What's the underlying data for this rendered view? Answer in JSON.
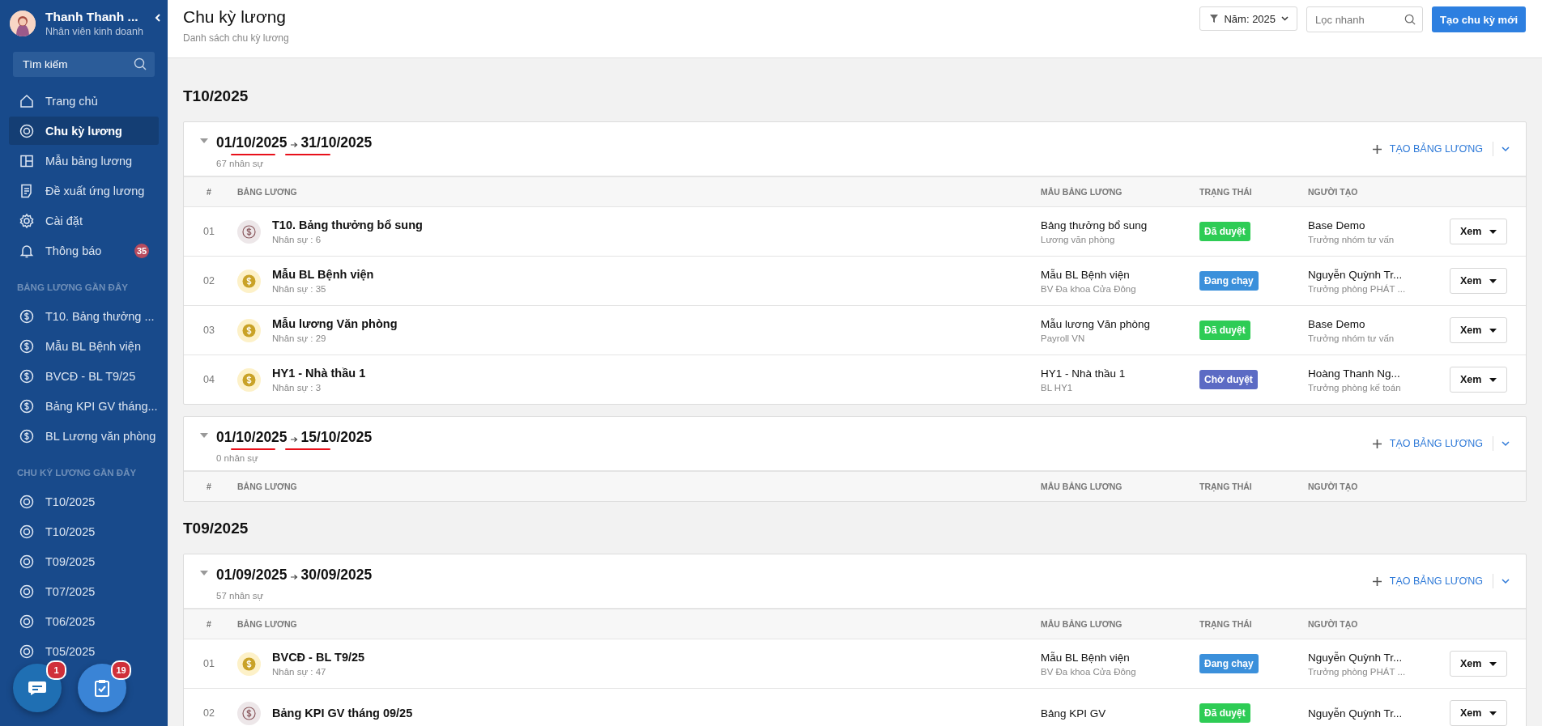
{
  "sidebar": {
    "user": {
      "name": "Thanh Thanh ...",
      "role": "Nhân viên kinh doanh"
    },
    "search": {
      "placeholder": "Tìm kiếm"
    },
    "nav": [
      {
        "label": "Trang chủ",
        "kind": "home",
        "selected": false
      },
      {
        "label": "Chu kỳ lương",
        "kind": "cycle",
        "selected": true
      },
      {
        "label": "Mẫu bảng lương",
        "kind": "template",
        "selected": false
      },
      {
        "label": "Đề xuất ứng lương",
        "kind": "proposal",
        "selected": false
      },
      {
        "label": "Cài đặt",
        "kind": "settings",
        "selected": false
      },
      {
        "label": "Thông báo",
        "kind": "bell",
        "selected": false,
        "badge": "35"
      }
    ],
    "sections": [
      {
        "title": "BẢNG LƯƠNG GẦN ĐÂY",
        "kind": "payroll",
        "items": [
          "T10. Bảng thưởng ...",
          "Mẫu BL Bệnh viện",
          "BVCĐ - BL T9/25",
          "Bảng KPI GV tháng...",
          "BL Lương văn phòng"
        ]
      },
      {
        "title": "CHU KỲ LƯƠNG GẦN ĐÂY",
        "kind": "cycle",
        "items": [
          "T10/2025",
          "T10/2025",
          "T09/2025",
          "T07/2025",
          "T06/2025",
          "T05/2025"
        ]
      }
    ]
  },
  "floating_buttons": [
    {
      "kind": "chat",
      "badge": "1"
    },
    {
      "kind": "tasks",
      "badge": "19"
    }
  ],
  "header": {
    "title": "Chu kỳ lương",
    "subtitle": "Danh sách chu kỳ lương",
    "year_filter": "Năm: 2025",
    "search": {
      "placeholder": "Lọc nhanh"
    },
    "create_button": "Tạo chu kỳ mới"
  },
  "groups": [
    {
      "title": "T10/2025",
      "cycles": [
        {
          "start": "01/10/2025",
          "end": "31/10/2025",
          "underlined": true,
          "staff": "67 nhân sự",
          "create_label": "TẠO BẢNG LƯƠNG",
          "columns": [
            "#",
            "BẢNG LƯƠNG",
            "MẪU BẢNG LƯƠNG",
            "TRẠNG THÁI",
            "NGƯỜI TẠO"
          ],
          "rows": [
            {
              "index": "01",
              "kind": "outline",
              "name": "T10. Bảng thưởng bổ sung",
              "staff": "Nhân sự : 6",
              "template": "Bảng thưởng bổ sung",
              "template_sub": "Lương văn phòng",
              "status": {
                "label": "Đã duyệt",
                "color": "#2ecc55"
              },
              "creator": "Base Demo",
              "creator_role": "Trưởng nhóm tư vấn",
              "action": "Xem"
            },
            {
              "index": "02",
              "kind": "coin",
              "name": "Mẫu BL Bệnh viện",
              "staff": "Nhân sự : 35",
              "template": "Mẫu BL Bệnh viện",
              "template_sub": "BV Đa khoa Cửa Đông",
              "status": {
                "label": "Đang chạy",
                "color": "#3b90db"
              },
              "creator": "Nguyễn Quỳnh Tr...",
              "creator_role": "Trưởng phòng PHÁT ...",
              "action": "Xem"
            },
            {
              "index": "03",
              "kind": "coin",
              "name": "Mẫu lương Văn phòng",
              "staff": "Nhân sự : 29",
              "template": "Mẫu lương Văn phòng",
              "template_sub": "Payroll VN",
              "status": {
                "label": "Đã duyệt",
                "color": "#2ecc55"
              },
              "creator": "Base Demo",
              "creator_role": "Trưởng nhóm tư vấn",
              "action": "Xem"
            },
            {
              "index": "04",
              "kind": "coin",
              "name": "HY1 - Nhà thầu 1",
              "staff": "Nhân sự : 3",
              "template": "HY1 - Nhà thầu 1",
              "template_sub": "BL HY1",
              "status": {
                "label": "Chờ duyệt",
                "color": "#5c6bc4"
              },
              "creator": "Hoàng Thanh Ng...",
              "creator_role": "Trưởng phòng kế toán",
              "action": "Xem"
            }
          ]
        },
        {
          "start": "01/10/2025",
          "end": "15/10/2025",
          "underlined": true,
          "staff": "0 nhân sự",
          "create_label": "TẠO BẢNG LƯƠNG",
          "columns": [
            "#",
            "BẢNG LƯƠNG",
            "MẪU BẢNG LƯƠNG",
            "TRẠNG THÁI",
            "NGƯỜI TẠO"
          ]
        }
      ]
    },
    {
      "title": "T09/2025",
      "cycles": [
        {
          "start": "01/09/2025",
          "end": "30/09/2025",
          "underlined": false,
          "staff": "57 nhân sự",
          "create_label": "TẠO BẢNG LƯƠNG",
          "columns": [
            "#",
            "BẢNG LƯƠNG",
            "MẪU BẢNG LƯƠNG",
            "TRẠNG THÁI",
            "NGƯỜI TẠO"
          ],
          "rows": [
            {
              "index": "01",
              "kind": "coin",
              "name": "BVCĐ - BL T9/25",
              "staff": "Nhân sự : 47",
              "template": "Mẫu BL Bệnh viện",
              "template_sub": "BV Đa khoa Cửa Đông",
              "status": {
                "label": "Đang chạy",
                "color": "#3b90db"
              },
              "creator": "Nguyễn Quỳnh Tr...",
              "creator_role": "Trưởng phòng PHÁT ...",
              "action": "Xem"
            },
            {
              "index": "02",
              "kind": "outline",
              "name": "Bảng KPI GV tháng 09/25",
              "template": "Bảng KPI GV",
              "status": {
                "label": "Đã duyệt",
                "color": "#2ecc55"
              },
              "creator": "Nguyễn Quỳnh Tr...",
              "action": "Xem"
            }
          ]
        }
      ]
    }
  ]
}
